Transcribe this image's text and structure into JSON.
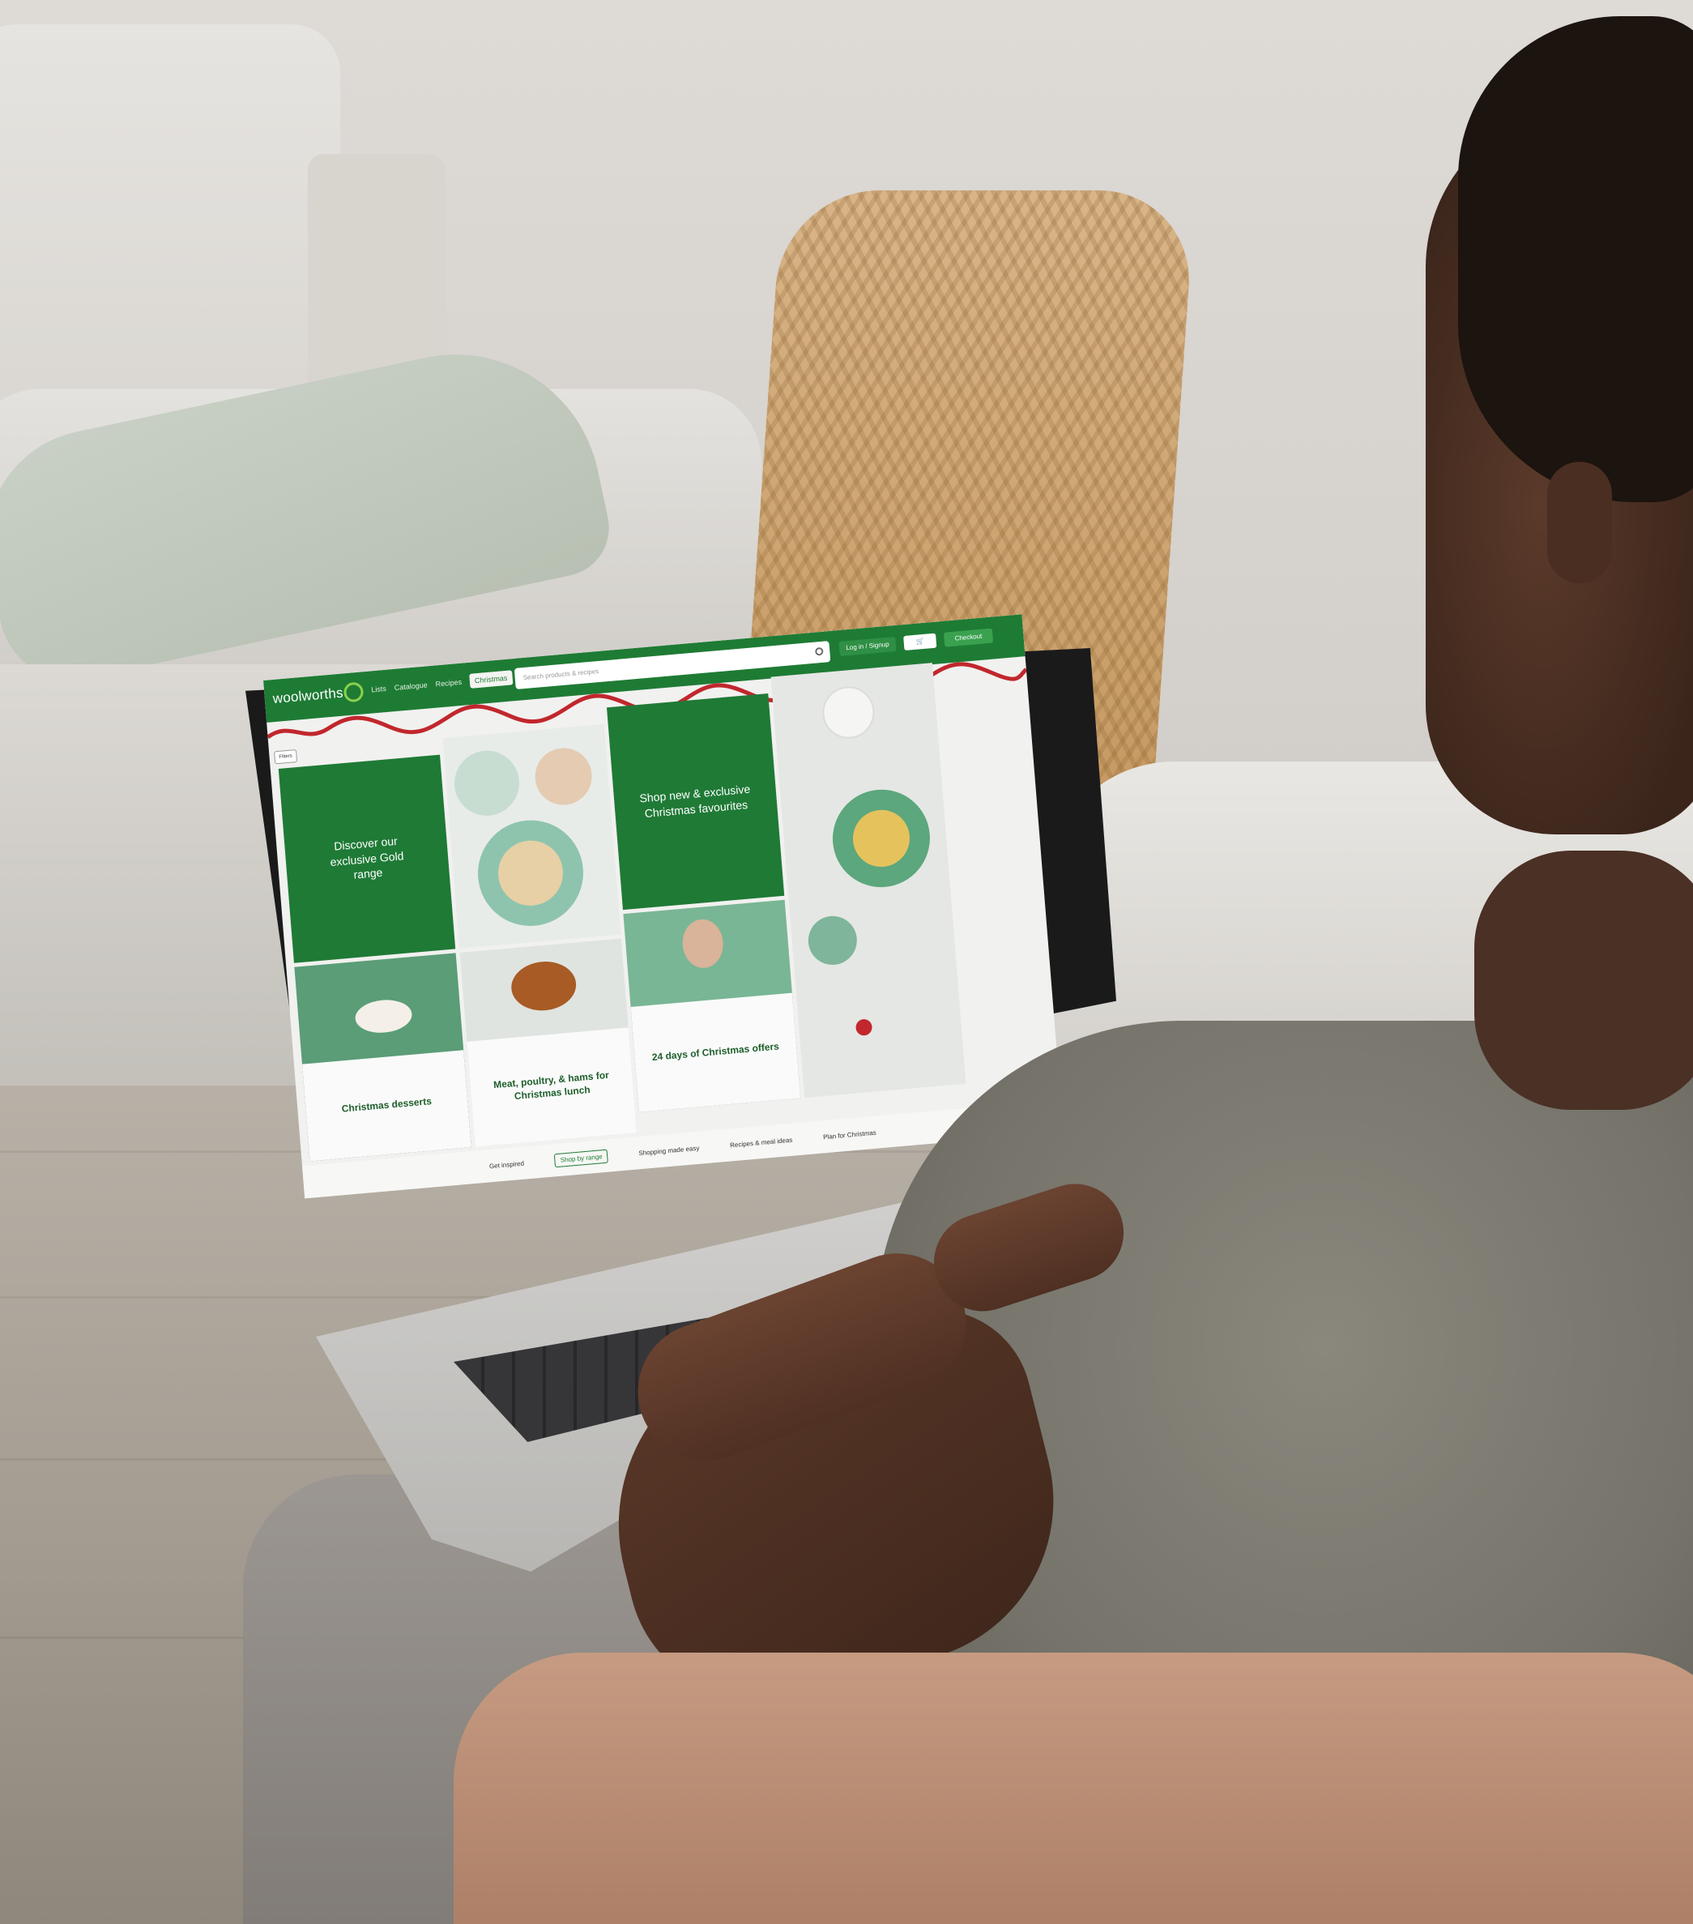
{
  "site": {
    "brand": "woolworths",
    "search_placeholder": "Search products & recipes",
    "nav_items": [
      "Lists",
      "Catalogue",
      "Recipes",
      "Christmas"
    ],
    "top_buttons": {
      "login": "Log in / Signup",
      "cart": "",
      "checkout": "Checkout"
    },
    "filter_chip": "Filters",
    "tiles": {
      "gold_range": "Discover our exclusive Gold range",
      "shop_new": "Shop new & exclusive Christmas favourites",
      "desserts": "Christmas desserts",
      "meat": "Meat, poultry, & hams for Christmas lunch",
      "offers": "24 days of Christmas offers"
    },
    "bottom_tabs": [
      "Get inspired",
      "Shop by range",
      "Shopping made easy",
      "Recipes & meal ideas",
      "Plan for Christmas"
    ],
    "colors": {
      "brand_green": "#1e7b34",
      "accent_green": "#8ad14c",
      "ribbon_red": "#c1272d"
    }
  }
}
